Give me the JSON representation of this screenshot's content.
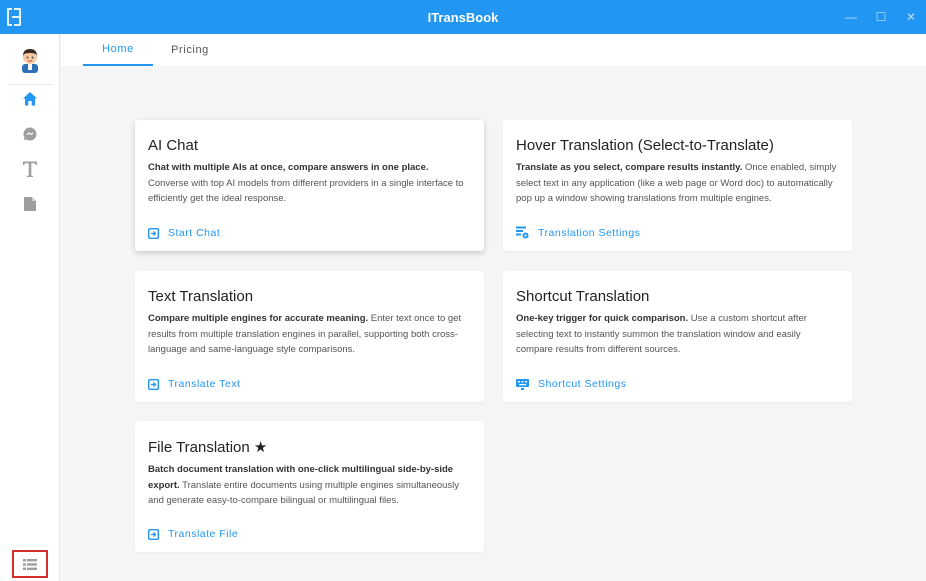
{
  "window": {
    "title": "ITransBook",
    "minimize_symbol": "—",
    "maximize_symbol": "☐",
    "close_symbol": "✕"
  },
  "sidebar": {
    "items": [
      {
        "name": "home",
        "icon": "home-icon",
        "active": true
      },
      {
        "name": "chat",
        "icon": "chat-bubble-icon"
      },
      {
        "name": "text-translation",
        "icon": "text-t-icon"
      },
      {
        "name": "file-translation",
        "icon": "document-icon"
      }
    ],
    "bottom_icon": "menu-list-icon"
  },
  "tabs": [
    {
      "label": "Home",
      "active": true
    },
    {
      "label": "Pricing",
      "active": false
    }
  ],
  "cards": {
    "ai_chat": {
      "title": "AI Chat",
      "bold": "Chat with multiple AIs at once, compare answers in one place.",
      "body": " Converse with top AI models from different providers in a single interface to efficiently get the ideal response.",
      "action": "Start Chat"
    },
    "hover": {
      "title": "Hover Translation (Select-to-Translate)",
      "bold": "Translate as you select, compare results instantly.",
      "body": " Once enabled, simply select text in any application (like a web page or Word doc) to automatically pop up a window showing translations from multiple engines.",
      "action": "Translation Settings"
    },
    "text": {
      "title": "Text Translation",
      "bold": "Compare multiple engines for accurate meaning.",
      "body": " Enter text once to get results from multiple translation engines in parallel, supporting both cross-language and same-language style comparisons.",
      "action": "Translate Text"
    },
    "shortcut": {
      "title": "Shortcut Translation",
      "bold": "One-key trigger for quick comparison.",
      "body": " Use a custom shortcut after selecting text to instantly summon the translation window and easily compare results from different sources.",
      "action": "Shortcut Settings"
    },
    "file": {
      "title": "File Translation ★",
      "bold": "Batch document translation with one-click multilingual side-by-side export.",
      "body": " Translate entire documents using multiple engines simultaneously and generate easy-to-compare bilingual or multilingual files.",
      "action": "Translate File"
    }
  },
  "colors": {
    "accent": "#2196f3",
    "sidebar_icon": "#9e9e9e",
    "highlight_box": "#d32f2f"
  }
}
